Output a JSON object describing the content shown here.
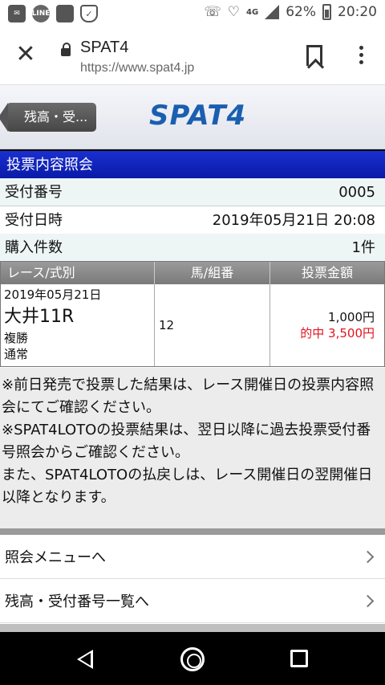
{
  "status_bar": {
    "left_icons": [
      "email-icon",
      "line-app-icon",
      "app-square-icon",
      "shield-icon"
    ],
    "network": "4G",
    "battery": "62%",
    "time": "20:20"
  },
  "browser": {
    "title": "SPAT4",
    "url": "https://www.spat4.jp"
  },
  "site": {
    "back_label": "残高・受...",
    "logo_text": "SPAT4",
    "brand_color": "#1a5fb0"
  },
  "section": {
    "title": "投票内容照会"
  },
  "info": {
    "receipt_label": "受付番号",
    "receipt_value": "0005",
    "datetime_label": "受付日時",
    "datetime_value": "2019年05月21日 20:08",
    "count_label": "購入件数",
    "count_value": "1件"
  },
  "table": {
    "headers": [
      "レース/式別",
      "馬/組番",
      "投票金額"
    ],
    "row": {
      "date": "2019年05月21日",
      "race": "大井11R",
      "bet_type": "複勝",
      "bet_mode": "通常",
      "horse": "12",
      "amount": "1,000円",
      "payout": "的中 3,500円"
    }
  },
  "notes": [
    "※前日発売で投票した結果は、レース開催日の投票内容照会にてご確認ください。",
    "※SPAT4LOTOの投票結果は、翌日以降に過去投票受付番号照会からご確認ください。",
    "また、SPAT4LOTOの払戻しは、レース開催日の翌開催日以降となります。"
  ],
  "nav_links": {
    "menu": "照会メニューへ",
    "balance_list": "残高・受付番号一覧へ"
  }
}
